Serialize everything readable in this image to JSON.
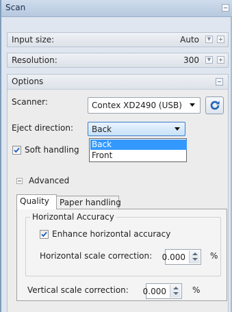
{
  "panel": {
    "title": "Scan"
  },
  "sections": {
    "input_size": {
      "label": "Input size:",
      "value": "Auto"
    },
    "resolution": {
      "label": "Resolution:",
      "value": "300"
    },
    "options": {
      "label": "Options"
    }
  },
  "options": {
    "scanner": {
      "label": "Scanner:",
      "selected": "Contex XD2490 (USB)"
    },
    "eject": {
      "label": "Eject direction:",
      "selected": "Back",
      "list": [
        "Back",
        "Front"
      ],
      "highlighted_index": 0
    },
    "soft_handling": {
      "label": "Soft handling",
      "checked": true
    },
    "advanced": {
      "label": "Advanced",
      "tabs": [
        {
          "label": "Quality",
          "active": true
        },
        {
          "label": "Paper handling",
          "active": false
        }
      ],
      "horizontal_accuracy": {
        "group_title": "Horizontal Accuracy",
        "enhance": {
          "label": "Enhance horizontal accuracy",
          "checked": true
        },
        "scale": {
          "label": "Horizontal scale correction:",
          "value": "0.000",
          "unit": "%"
        }
      },
      "vertical_scale": {
        "label": "Vertical scale correction:",
        "value": "0.000",
        "unit": "%"
      }
    }
  },
  "icons": {
    "refresh": "refresh-icon",
    "checkmark": "checkmark-icon",
    "collapse": "collapse-icon",
    "expand": "plus-icon",
    "dropdown": "chevron-down-icon"
  },
  "colors": {
    "accent": "#3399ff",
    "title_bar": "#c3d3e7"
  }
}
